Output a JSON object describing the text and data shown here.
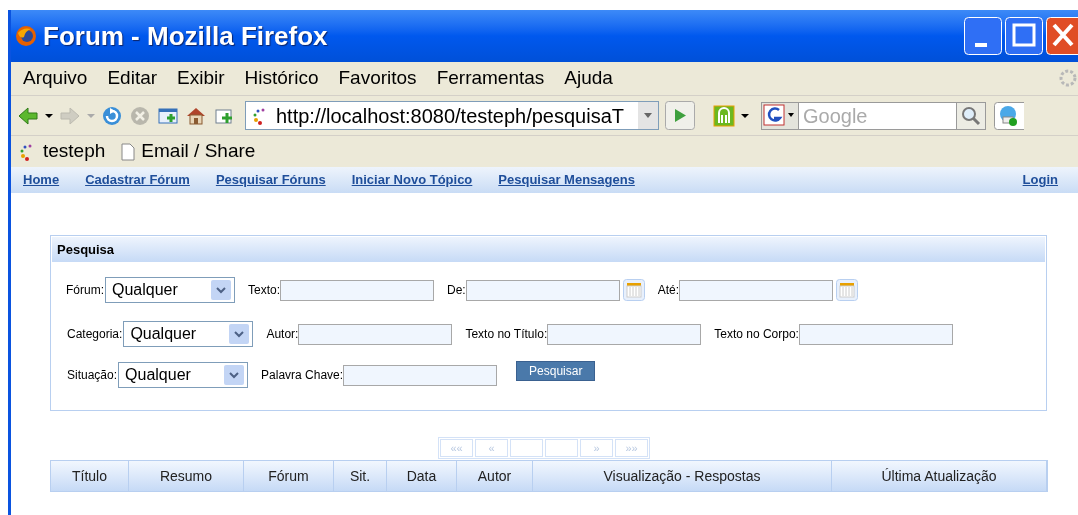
{
  "window": {
    "title": "Forum - Mozilla Firefox"
  },
  "menu": [
    "Arquivo",
    "Editar",
    "Exibir",
    "Histórico",
    "Favoritos",
    "Ferramentas",
    "Ajuda"
  ],
  "toolbar": {
    "buttons": [
      {
        "kind": "back",
        "disabled": false
      },
      {
        "kind": "forward",
        "disabled": true
      },
      {
        "kind": "reload",
        "disabled": false
      },
      {
        "kind": "stop",
        "disabled": true
      },
      {
        "kind": "new-tab",
        "disabled": false
      },
      {
        "kind": "home",
        "disabled": false
      },
      {
        "kind": "bookmark-add",
        "disabled": false
      }
    ],
    "address": "http://localhost:8080/testeph/pesquisaT",
    "search": {
      "placeholder": "Google"
    }
  },
  "bookmarks": [
    {
      "kind": "site",
      "label": "testeph"
    },
    {
      "kind": "page",
      "label": "Email / Share"
    }
  ],
  "nav_links": [
    "Home",
    "Cadastrar Fórum",
    "Pesquisar Fóruns",
    "Iniciar Novo Tópico",
    "Pesquisar Mensagens"
  ],
  "login_link": "Login",
  "search_panel": {
    "title": "Pesquisa",
    "rows": [
      [
        {
          "kind": "select",
          "label": "Fórum:",
          "value": "Qualquer"
        },
        {
          "kind": "text",
          "label": "Texto:"
        },
        {
          "kind": "date",
          "label": "De:"
        },
        {
          "kind": "date",
          "label": "Até:"
        }
      ],
      [
        {
          "kind": "select",
          "label": "Categoria:",
          "value": "Qualquer"
        },
        {
          "kind": "text",
          "label": "Autor:"
        },
        {
          "kind": "text",
          "label": "Texto no Título:"
        },
        {
          "kind": "text",
          "label": "Texto no Corpo:"
        }
      ],
      [
        {
          "kind": "select",
          "label": "Situação:",
          "value": "Qualquer"
        },
        {
          "kind": "text",
          "label": "Palavra Chave:"
        },
        {
          "kind": "button",
          "label": "Pesquisar"
        }
      ]
    ]
  },
  "pagination": [
    {
      "kind": "arrow",
      "label": "««",
      "disabled": true
    },
    {
      "kind": "arrow",
      "label": "«",
      "disabled": true
    },
    {
      "kind": "blank",
      "disabled": true
    },
    {
      "kind": "blank",
      "disabled": true
    },
    {
      "kind": "arrow",
      "label": "»",
      "disabled": true
    },
    {
      "kind": "arrow",
      "label": "»»",
      "disabled": true
    }
  ],
  "table": {
    "columns": [
      "Título",
      "Resumo",
      "Fórum",
      "Sit.",
      "Data",
      "Autor",
      "Visualização - Respostas",
      "Última Atualização"
    ]
  }
}
